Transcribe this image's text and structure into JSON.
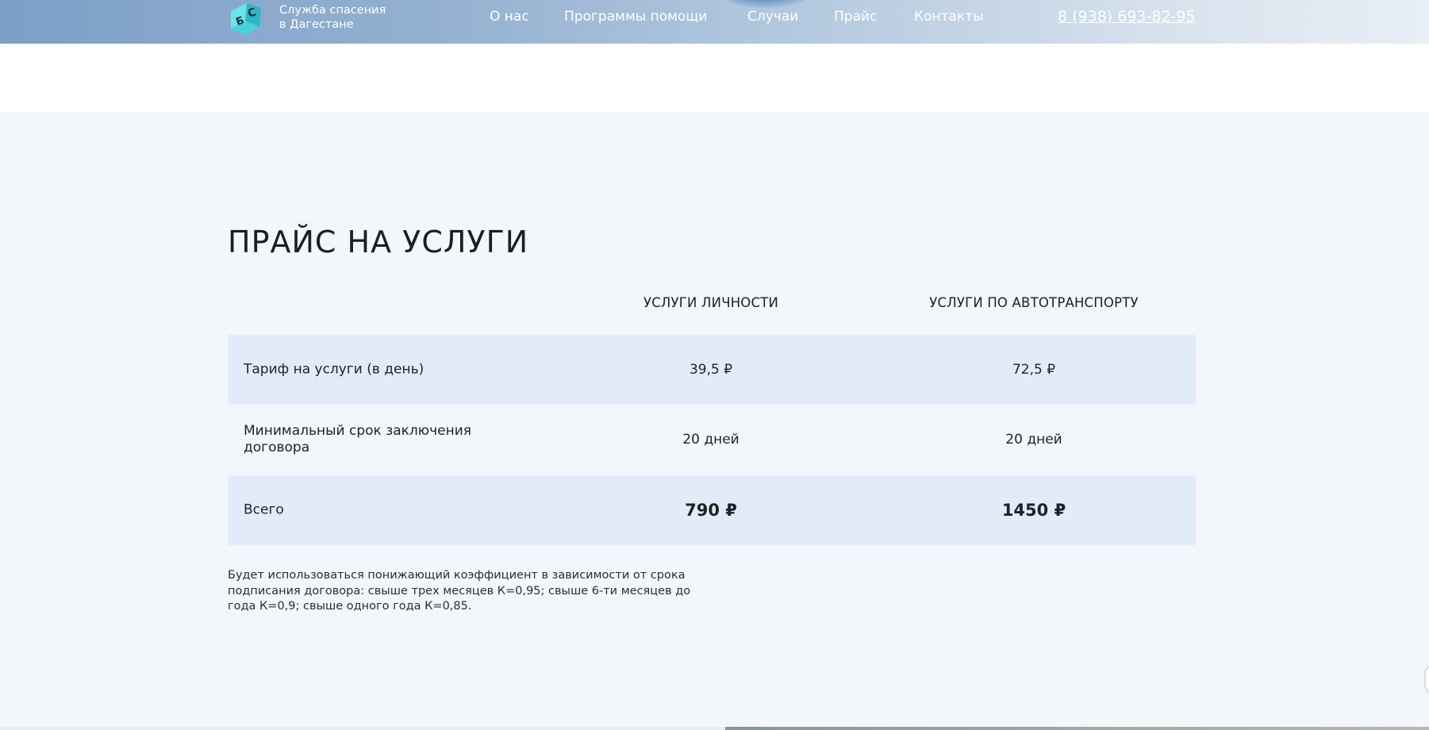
{
  "header": {
    "logo_letters": "БС",
    "logo_line1": "Служба спасения",
    "logo_line2": "в Дагестане",
    "nav": [
      {
        "label": "О нас"
      },
      {
        "label": "Программы помощи"
      },
      {
        "label": "Случаи"
      },
      {
        "label": "Прайс"
      },
      {
        "label": "Контакты"
      }
    ],
    "phone": "8 (938) 693-82-95"
  },
  "pricing": {
    "title": "ПРАЙС НА УСЛУГИ",
    "columns": [
      "УСЛУГИ ЛИЧНОСТИ",
      "УСЛУГИ ПО АВТОТРАНСПОРТУ"
    ],
    "rows": [
      {
        "label": "Тариф на услуги (в день)",
        "values": [
          "39,5 ₽",
          "72,5 ₽"
        ]
      },
      {
        "label": "Минимальный срок заключения договора",
        "values": [
          "20 дней",
          "20 дней"
        ]
      },
      {
        "label": "Всего",
        "values": [
          "790 ₽",
          "1450 ₽"
        ]
      }
    ],
    "note": "Будет использоваться понижающий коэффициент в зависимости от срока подписания договора: свыше трех месяцев К=0,95; свыше 6-ти месяцев до года К=0,9; свыше одного года К=0,85."
  },
  "colors": {
    "header_start": "#7d9fc6",
    "header_end": "#e8eef5",
    "section_bg": "#f3f6fb",
    "row_shade": "#e2ecf8",
    "logo_cube": "#3fd0d8"
  }
}
